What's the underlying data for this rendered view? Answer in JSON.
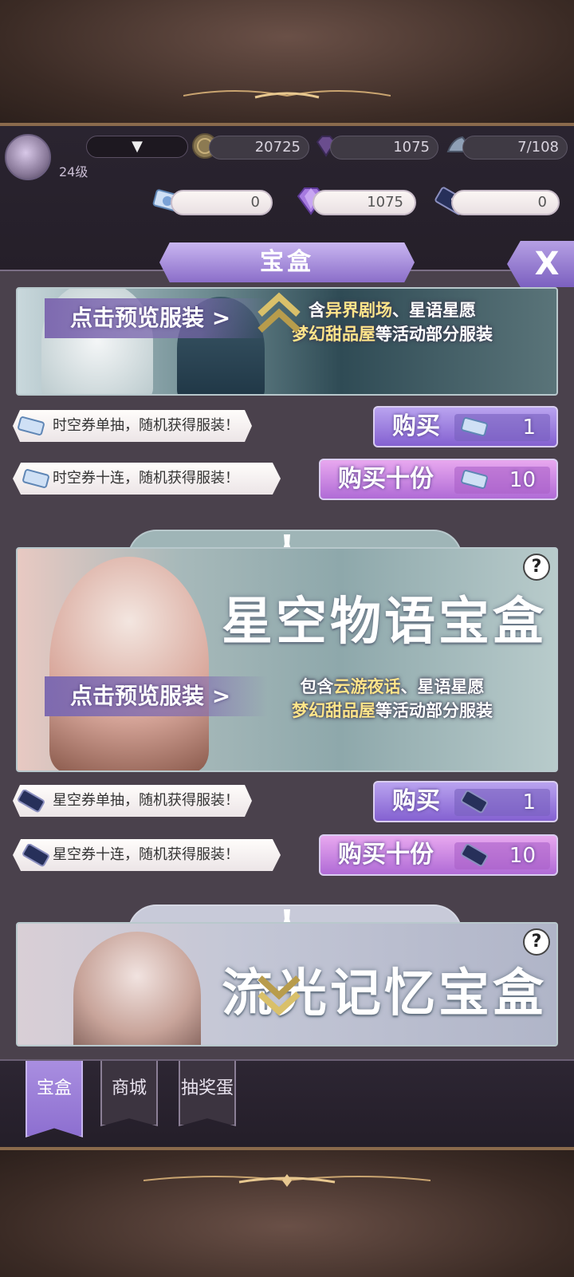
{
  "header": {
    "level": "24级",
    "dropdown_icon": "▼",
    "gold": "20725",
    "diamond": "1075",
    "stamina": "7/108"
  },
  "tickets": {
    "spacetime": "0",
    "diamond": "1075",
    "starry": "0"
  },
  "panel": {
    "title": "宝盒",
    "close_label": "X"
  },
  "boxes": [
    {
      "preview_label": "点击预览服装 >",
      "desc_plain_1": "含",
      "desc_highlight_1": "异界剧场",
      "desc_plain_2": "、星语星愿",
      "desc_line2_highlight": "梦幻甜品屋",
      "desc_line2_plain": "等活动部分服装",
      "single_note": "时空券单抽，随机获得服装！",
      "ten_note": "时空券十连，随机获得服装！",
      "buy_single_label": "购买",
      "buy_single_count": "1",
      "buy_ten_label": "购买十份",
      "buy_ten_count": "10"
    },
    {
      "title": "星空物语宝盒",
      "help": "?",
      "preview_label": "点击预览服装 >",
      "desc_line1_plain": "包含",
      "desc_line1_highlight": "云游夜话",
      "desc_line1_plain2": "、星语星愿",
      "desc_line2_highlight": "梦幻甜品屋",
      "desc_line2_plain": "等活动部分服装",
      "single_note": "星空券单抽，随机获得服装！",
      "ten_note": "星空券十连，随机获得服装！",
      "buy_single_label": "购买",
      "buy_single_count": "1",
      "buy_ten_label": "购买十份",
      "buy_ten_count": "10"
    },
    {
      "title": "流光记忆宝盒",
      "help": "?"
    }
  ],
  "tabs": [
    {
      "label": "宝盒",
      "active": true
    },
    {
      "label": "商城",
      "active": false
    },
    {
      "label": "抽奖蛋",
      "active": false
    }
  ],
  "colors": {
    "accent_purple": "#8461d1",
    "accent_pink": "#b06bd6",
    "highlight_yellow": "#ffe58a"
  }
}
